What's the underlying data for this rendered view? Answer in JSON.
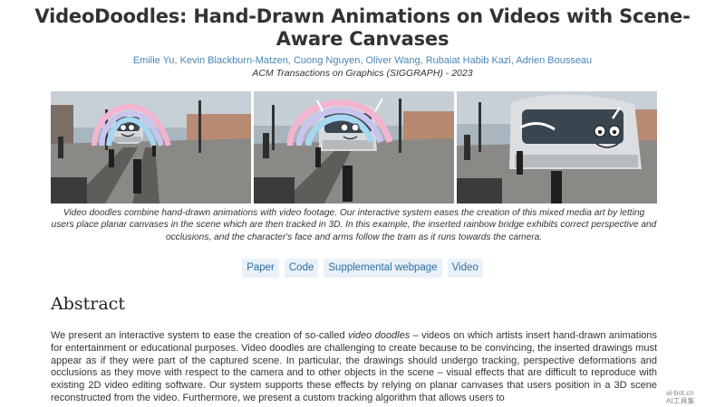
{
  "header": {
    "title": "VideoDoodles: Hand-Drawn Animations on Videos with Scene-Aware Canvases",
    "authors": [
      "Emilie Yu",
      "Kevin Blackburn-Matzen",
      "Cuong Nguyen",
      "Oliver Wang",
      "Rubaiat Habib Kazi",
      "Adrien Bousseau"
    ],
    "author_separator": ", ",
    "venue": "ACM Transactions on Graphics (SIGGRAPH) - 2023"
  },
  "figure": {
    "caption": "Video doodles combine hand-drawn animations with video footage. Our interactive system eases the creation of this mixed media art by letting users place planar canvases in the scene which are then tracked in 3D. In this example, the inserted rainbow bridge exhibits correct perspective and occlusions, and the character's face and arms follow the tram as it runs towards the camera."
  },
  "links": [
    {
      "label": "Paper"
    },
    {
      "label": "Code"
    },
    {
      "label": "Supplemental webpage"
    },
    {
      "label": "Video"
    }
  ],
  "abstract": {
    "heading": "Abstract",
    "text_before": "We present an interactive system to ease the creation of so-called ",
    "emphasis": "video doodles",
    "text_after": " – videos on which artists insert hand-drawn animations for entertainment or educational purposes. Video doodles are challenging to create because to be convincing, the inserted drawings must appear as if they were part of the captured scene. In particular, the drawings should undergo tracking, perspective deformations and occlusions as they move with respect to the camera and to other objects in the scene – visual effects that are difficult to reproduce with existing 2D video editing software. Our system supports these effects by relying on planar canvases that users position in a 3D scene reconstructed from the video. Furthermore, we present a custom tracking algorithm that allows users to"
  },
  "watermark": {
    "line1": "ai-bot.cn",
    "line2": "AI工具集"
  },
  "colors": {
    "link": "#4a86b5",
    "button_bg": "#e9f1f9",
    "button_text": "#2f6f9f"
  }
}
